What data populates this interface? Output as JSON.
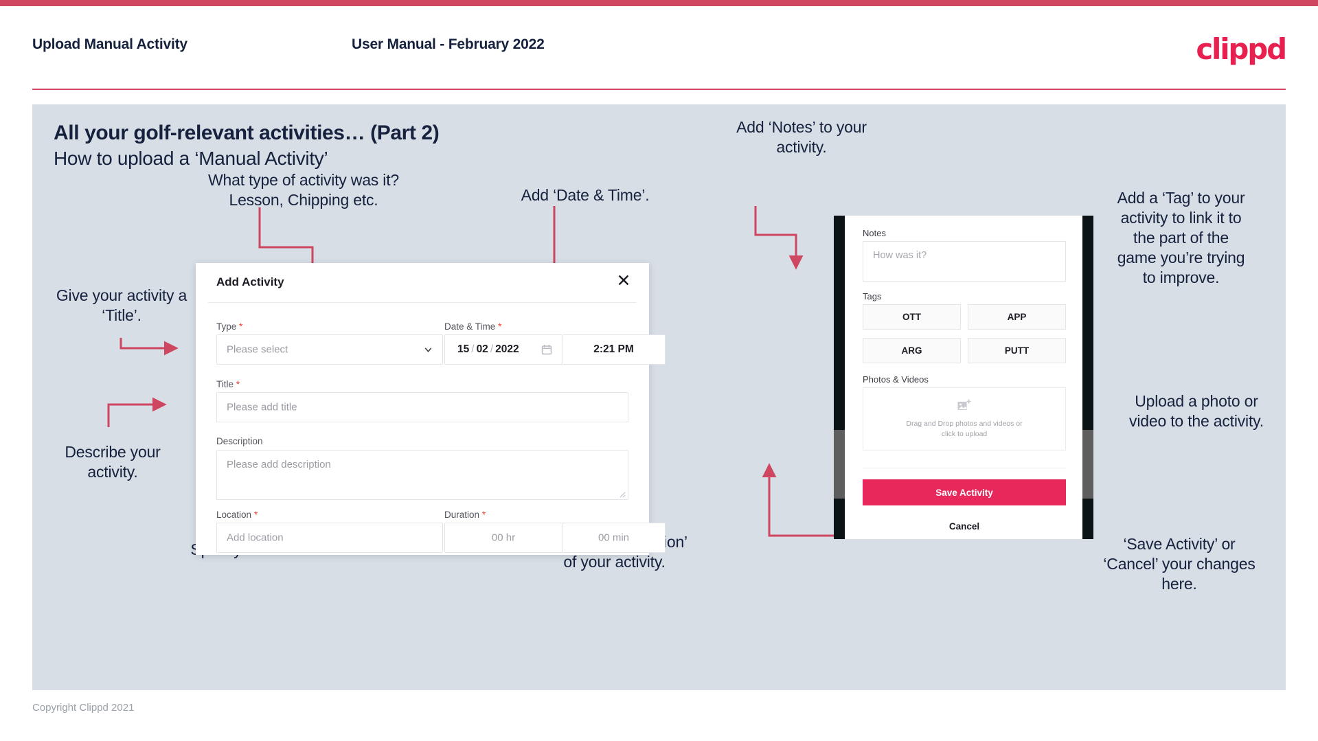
{
  "brand": {
    "logo_text": "clippd",
    "accent_color": "#cf4661",
    "primary_color": "#e8204f",
    "save_button_color": "#e8275a",
    "slide_bg_color": "#d7dee6",
    "text_color": "#16213d"
  },
  "header": {
    "title": "Upload Manual Activity",
    "subtitle": "User Manual - February 2022"
  },
  "slide": {
    "title": "All your golf-relevant activities… (Part 2)",
    "subtitle": "How to upload a ‘Manual Activity’"
  },
  "annotations": {
    "type": "What type of activity was it?\nLesson, Chipping etc.",
    "type_line1": "What type of activity was it?",
    "type_line2": "Lesson, Chipping etc.",
    "datetime": "Add ‘Date & Time’.",
    "notes_line1": "Add ‘Notes’ to your",
    "notes_line2": "activity.",
    "tag_line1": "Add a ‘Tag’ to your",
    "tag_line2": "activity to link it to",
    "tag_line3": "the part of the",
    "tag_line4": "game you’re trying",
    "tag_line5": "to improve.",
    "title_line1": "Give your activity a",
    "title_line2": "‘Title’.",
    "describe_line1": "Describe your",
    "describe_line2": "activity.",
    "location": "Specify the ‘Location’.",
    "duration_line1": "Specify the ‘Duration’",
    "duration_line2": "of your activity.",
    "upload_line1": "Upload a photo or",
    "upload_line2": "video to the activity.",
    "save_line1": "‘Save Activity’ or",
    "save_line2": "‘Cancel’ your changes",
    "save_line3": "here."
  },
  "dialog": {
    "title": "Add Activity",
    "close_icon": "close-icon",
    "fields": {
      "type": {
        "label": "Type",
        "required": "*",
        "placeholder": "Please select",
        "icon": "chevron-down-icon"
      },
      "datetime": {
        "label": "Date & Time",
        "required": "*",
        "day": "15",
        "month": "02",
        "year": "2022",
        "separator": "/",
        "time": "2:21 PM",
        "icon": "calendar-icon"
      },
      "title": {
        "label": "Title",
        "required": "*",
        "placeholder": "Please add title"
      },
      "description": {
        "label": "Description",
        "required": "",
        "placeholder": "Please add description"
      },
      "location": {
        "label": "Location",
        "required": "*",
        "placeholder": "Add location"
      },
      "duration": {
        "label": "Duration",
        "required": "*",
        "hours_placeholder": "00 hr",
        "minutes_placeholder": "00 min"
      }
    }
  },
  "phone": {
    "notes": {
      "label": "Notes",
      "placeholder": "How was it?"
    },
    "tags": {
      "label": "Tags",
      "items": [
        "OTT",
        "APP",
        "ARG",
        "PUTT"
      ]
    },
    "photos": {
      "label": "Photos & Videos",
      "icon": "add-image-icon",
      "drop_line1": "Drag and Drop photos and videos or",
      "drop_line2": "click to upload"
    },
    "save_label": "Save Activity",
    "cancel_label": "Cancel"
  },
  "footer": {
    "copyright": "Copyright Clippd 2021"
  }
}
